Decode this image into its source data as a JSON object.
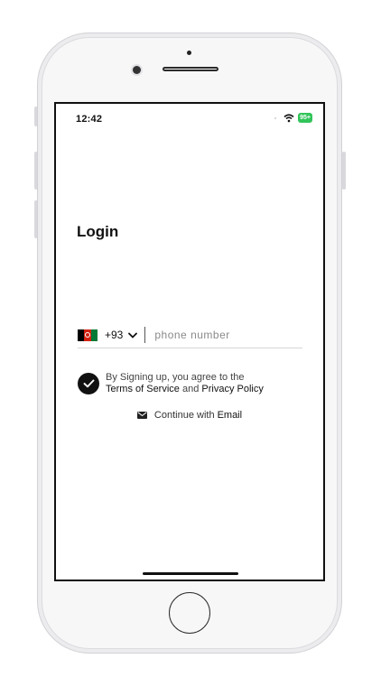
{
  "status_bar": {
    "time": "12:42",
    "battery": "95+"
  },
  "login": {
    "title": "Login",
    "country_code": "+93",
    "phone_placeholder": "phone number",
    "terms_prefix": "By Signing up, you agree to the",
    "terms_of_service": "Terms of Service",
    "terms_and": "and",
    "privacy_policy": "Privacy Policy",
    "continue_prefix": "Continue with",
    "continue_email": "Email"
  },
  "icons": {
    "flag": "afghanistan-flag-icon",
    "chevron": "chevron-down-icon",
    "check": "checkmark-icon",
    "mail": "mail-icon",
    "wifi": "wifi-icon"
  },
  "colors": {
    "primary": "#111111",
    "battery": "#31c45a",
    "flag_black": "#000000",
    "flag_red": "#d32011",
    "flag_green": "#007a36"
  }
}
